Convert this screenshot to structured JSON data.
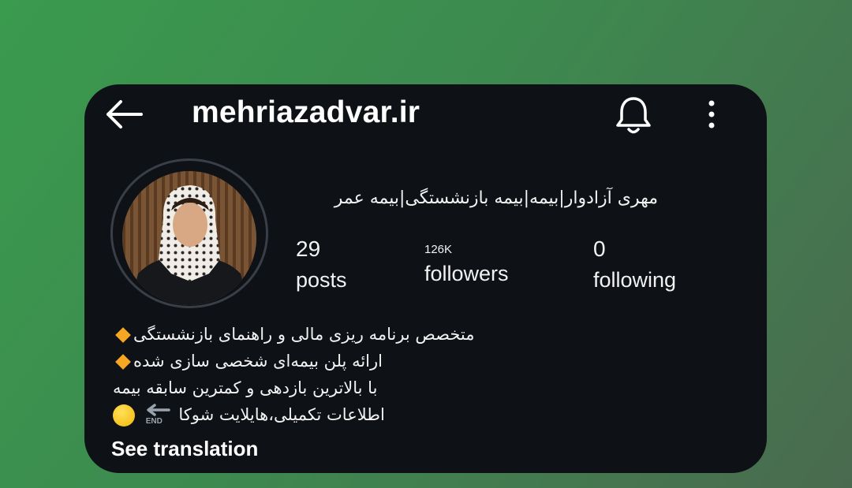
{
  "header": {
    "username": "mehriazadvar.ir"
  },
  "profile": {
    "display_name": "مهری آزادوار|بیمه|بیمه بازنشستگی|بیمه عمر"
  },
  "stats": {
    "posts": {
      "count": "29",
      "label": "posts"
    },
    "followers": {
      "count": "126K",
      "label": "followers"
    },
    "following": {
      "count": "0",
      "label": "following"
    }
  },
  "bio": {
    "line1": "متخصص برنامه ریزی مالی و راهنمای بازنشستگی",
    "line2": "ارائه پلن بیمه‌ای شخصی سازی شده",
    "line3": "با بالاترین بازدهی و کمترین سابقه بیمه",
    "line4": "اطلاعات تکمیلی،هایلایت شوکا",
    "end_badge": "END"
  },
  "see_translation": "See translation",
  "colors": {
    "background": "#3d8a4f",
    "card": "#0e1116",
    "text": "#f2f2f2",
    "emoji_diamond": "#f5a623",
    "emoji_circle": "#f7c21a"
  },
  "icons": [
    "arrow-left-icon",
    "bell-icon",
    "more-vertical-icon",
    "diamond-emoji-icon",
    "end-arrow-icon",
    "yellow-circle-emoji-icon"
  ]
}
